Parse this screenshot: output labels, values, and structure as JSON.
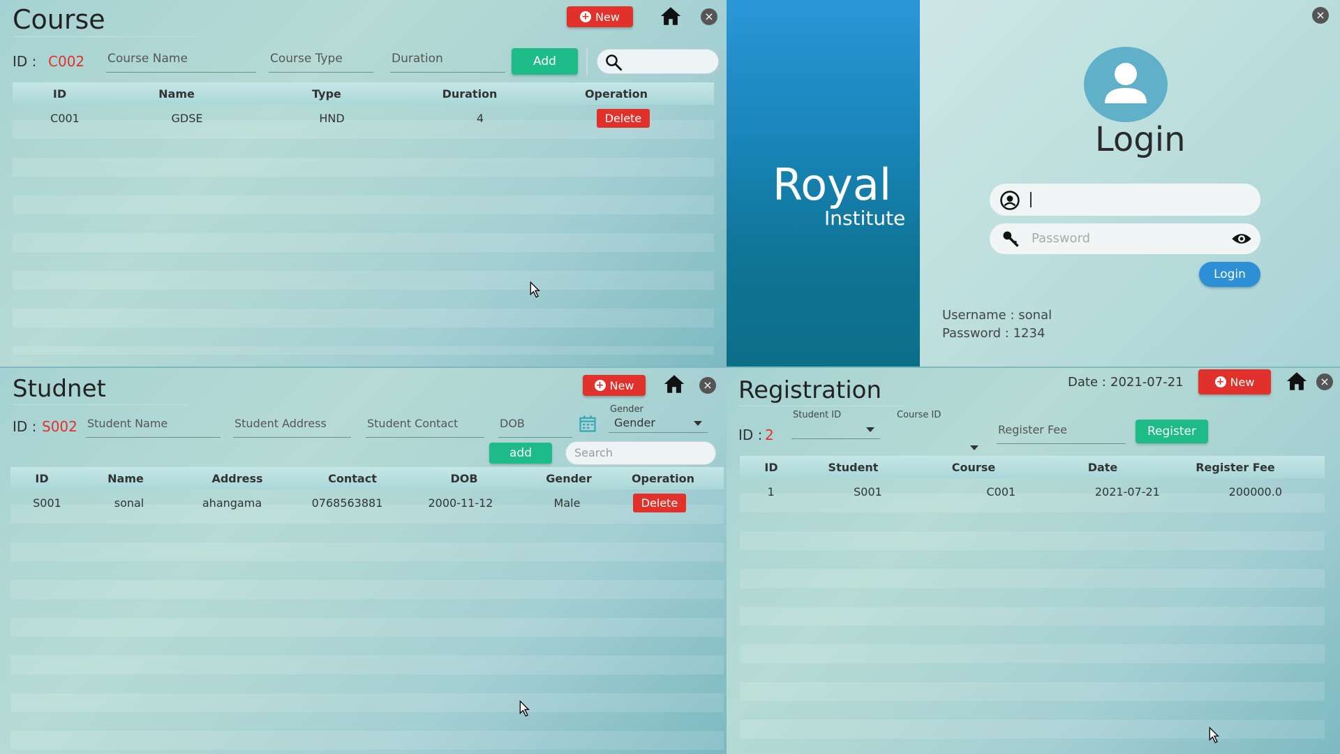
{
  "course": {
    "title": "Course",
    "new_label": "New",
    "id_label": "ID :",
    "id_value": "C002",
    "name_placeholder": "Course Name",
    "type_placeholder": "Course Type",
    "duration_placeholder": "Duration",
    "add_label": "Add",
    "columns": [
      "ID",
      "Name",
      "Type",
      "Duration",
      "Operation"
    ],
    "rows": [
      {
        "id": "C001",
        "name": "GDSE",
        "type": "HND",
        "duration": "4",
        "op": "Delete"
      }
    ]
  },
  "student": {
    "title": "Studnet",
    "new_label": "New",
    "id_label": "ID :",
    "id_value": "S002",
    "name_placeholder": "Student Name",
    "address_placeholder": "Student Address",
    "contact_placeholder": "Student Contact",
    "dob_placeholder": "DOB",
    "gender_label": "Gender",
    "gender_value": "Gender",
    "add_label": "add",
    "search_placeholder": "Search",
    "columns": [
      "ID",
      "Name",
      "Address",
      "Contact",
      "DOB",
      "Gender",
      "Operation"
    ],
    "rows": [
      {
        "id": "S001",
        "name": "sonal",
        "address": "ahangama",
        "contact": "0768563881",
        "dob": "2000-11-12",
        "gender": "Male",
        "op": "Delete"
      }
    ]
  },
  "brand": {
    "name": "Royal",
    "subtitle": "Institute"
  },
  "login": {
    "title": "Login",
    "username_value": "",
    "password_placeholder": "Password",
    "button_label": "Login",
    "hint_username": "Username : sonal",
    "hint_password": "Password : 1234"
  },
  "registration": {
    "title": "Registration",
    "date_label": "Date :",
    "date_value": "2021-07-21",
    "new_label": "New",
    "id_label": "ID :",
    "id_value": "2",
    "student_id_label": "Student ID",
    "course_id_label": "Course ID",
    "fee_placeholder": "Register Fee",
    "register_label": "Register",
    "columns": [
      "ID",
      "Student",
      "Course",
      "Date",
      "Register Fee"
    ],
    "rows": [
      {
        "id": "1",
        "student": "S001",
        "course": "C001",
        "date": "2021-07-21",
        "fee": "200000.0"
      }
    ]
  },
  "colors": {
    "accent_red": "#e2312a",
    "accent_green": "#1dbb87",
    "brand_blue": "#1a86bc",
    "login_blue": "#2d8fd6"
  },
  "icons": [
    "plus-icon",
    "home-icon",
    "close-icon",
    "search-icon",
    "calendar-icon",
    "chevron-down-icon",
    "user-avatar-icon",
    "user-circle-icon",
    "key-icon",
    "eye-icon"
  ]
}
